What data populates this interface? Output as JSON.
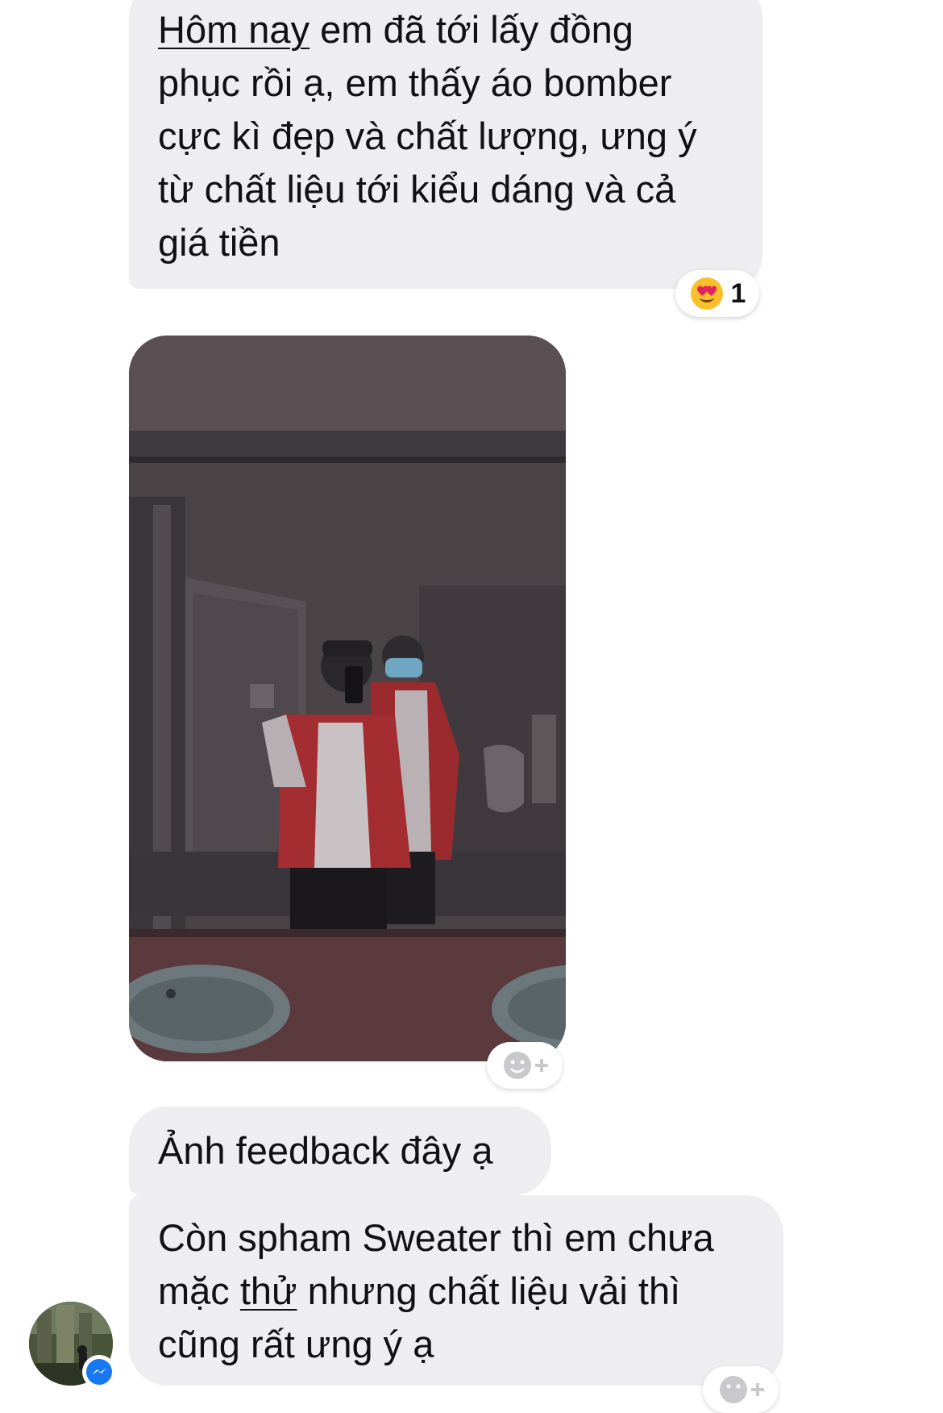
{
  "messages": [
    {
      "lines": [
        {
          "underlined": "Hôm nay",
          "rest": " em đã tới lấy đồng"
        },
        {
          "text": "phục rồi ạ, em thấy áo bomber"
        },
        {
          "text": "cực kì đẹp và chất lượng, ưng ý"
        },
        {
          "text": "từ chất liệu tới kiểu dáng và cả"
        },
        {
          "text": "giá tiền"
        }
      ],
      "reaction": {
        "icon": "heart-eyes-emoji-icon",
        "count": "1"
      }
    },
    {
      "type": "photo",
      "photo_icon": "mirror-selfie-photo"
    },
    {
      "lines": [
        {
          "text": "Ảnh feedback đây ạ"
        }
      ]
    },
    {
      "lines": [
        {
          "text": "Còn spham Sweater thì em chưa"
        },
        {
          "before": "mặc ",
          "underlined": "thử",
          "rest": " nhưng chất liệu vải thì"
        },
        {
          "text": "cũng rất ưng ý ạ"
        }
      ]
    }
  ],
  "icons": {
    "add_reaction": "add-reaction-icon",
    "avatar": "user-avatar",
    "badge": "messenger-badge-icon"
  },
  "colors": {
    "bubble": "#eeeef0",
    "messenger_blue": "#1877f2",
    "reaction_yellow": "#f7c02c",
    "heart_red": "#e0245e"
  }
}
